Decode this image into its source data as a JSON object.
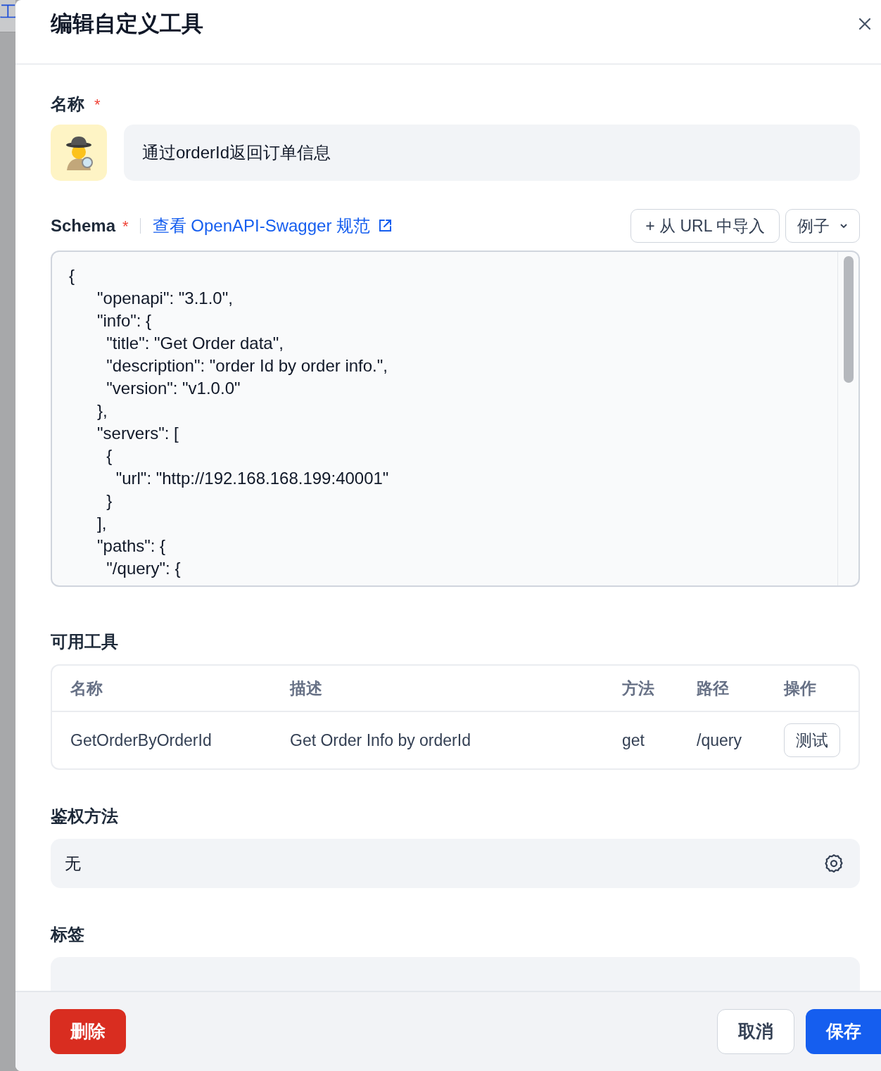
{
  "background_page": {
    "fragment": "工"
  },
  "dialog": {
    "title": "编辑自定义工具"
  },
  "name_field": {
    "label": "名称",
    "required_mark": "*",
    "value": "通过orderId返回订单信息"
  },
  "schema": {
    "label": "Schema",
    "required_mark": "*",
    "spec_link": "查看 OpenAPI-Swagger 规范",
    "import_button": "+ 从 URL 中导入",
    "examples_button": "例子",
    "code_lines": [
      "{",
      "      \"openapi\": \"3.1.0\",",
      "      \"info\": {",
      "        \"title\": \"Get Order data\",",
      "        \"description\": \"order Id by order info.\",",
      "        \"version\": \"v1.0.0\"",
      "      },",
      "      \"servers\": [",
      "        {",
      "          \"url\": \"http://192.168.168.199:40001\"",
      "        }",
      "      ],",
      "      \"paths\": {",
      "        \"/query\": {"
    ]
  },
  "available_tools": {
    "label": "可用工具",
    "columns": [
      "名称",
      "描述",
      "方法",
      "路径",
      "操作"
    ],
    "rows": [
      {
        "name": "GetOrderByOrderId",
        "description": "Get Order Info by orderId",
        "method": "get",
        "path": "/query",
        "action": "测试"
      }
    ]
  },
  "auth": {
    "label": "鉴权方法",
    "value": "无"
  },
  "tags": {
    "label": "标签"
  },
  "footer": {
    "delete": "删除",
    "cancel": "取消",
    "save": "保存"
  }
}
